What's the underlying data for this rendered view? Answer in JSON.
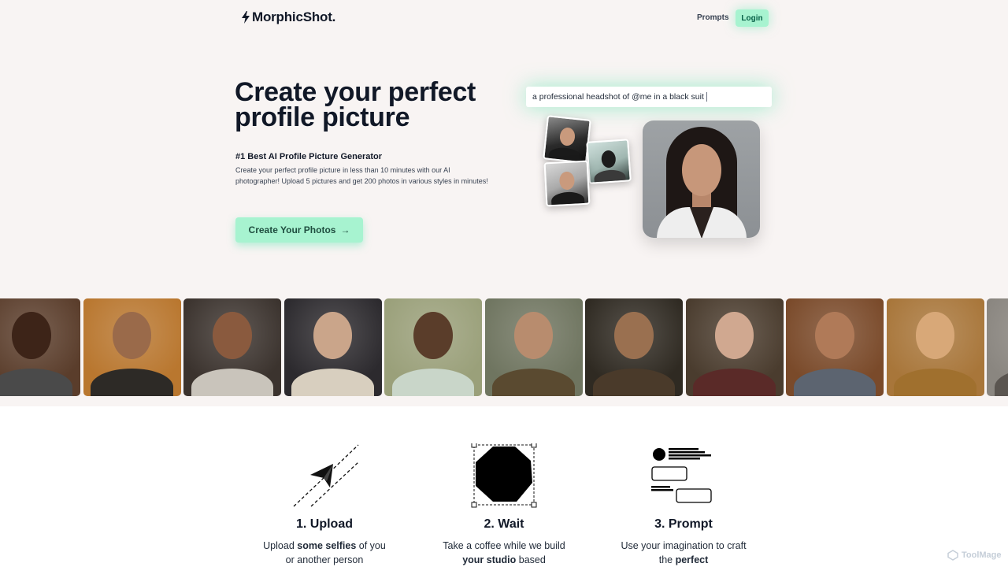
{
  "header": {
    "logo_text": "MorphicShot.",
    "nav": {
      "prompts_label": "Prompts",
      "login_label": "Login"
    }
  },
  "hero": {
    "title": "Create your perfect profile picture",
    "subtitle": "#1 Best AI Profile Picture Generator",
    "description": "Create your perfect profile picture in less than 10 minutes with our AI photographer! Upload 5 pictures and get 200 photos in various styles in minutes!",
    "cta_label": "Create Your Photos",
    "prompt_text": "a professional headshot of @me in a black suit"
  },
  "gallery": {
    "items": [
      {
        "bg": "#5a3d2b",
        "head": "#3d2418",
        "body": "#4a4a4a"
      },
      {
        "bg": "#b9772f",
        "head": "#9a6a4a",
        "body": "#2d2a26"
      },
      {
        "bg": "#3b332e",
        "head": "#8a5a3e",
        "body": "#c9c4bb"
      },
      {
        "bg": "#2c2a2e",
        "head": "#caa58a",
        "body": "#d8cfbf"
      },
      {
        "bg": "#9aa07a",
        "head": "#5a3d2a",
        "body": "#c9d6c9"
      },
      {
        "bg": "#6f7560",
        "head": "#b88c6e",
        "body": "#5a4a30"
      },
      {
        "bg": "#2f2a22",
        "head": "#9a7050",
        "body": "#4a3a2a"
      },
      {
        "bg": "#4a3c2e",
        "head": "#d0a890",
        "body": "#5a2a28"
      },
      {
        "bg": "#7a4a2a",
        "head": "#b07a58",
        "body": "#5c6470"
      },
      {
        "bg": "#a8763a",
        "head": "#d8a878",
        "body": "#a0702e"
      },
      {
        "bg": "#8a8680",
        "head": "#c09a80",
        "body": "#5a5550"
      }
    ]
  },
  "steps": [
    {
      "title": "1. Upload",
      "desc_pre": "Upload ",
      "desc_bold": "some selfies",
      "desc_post": " of you or another person"
    },
    {
      "title": "2. Wait",
      "desc_pre": "Take a coffee while we build ",
      "desc_bold": "your studio",
      "desc_post": " based"
    },
    {
      "title": "3. Prompt",
      "desc_pre": "Use your imagination to craft the ",
      "desc_bold": "perfect",
      "desc_post": ""
    }
  ],
  "watermark": "ToolMage"
}
